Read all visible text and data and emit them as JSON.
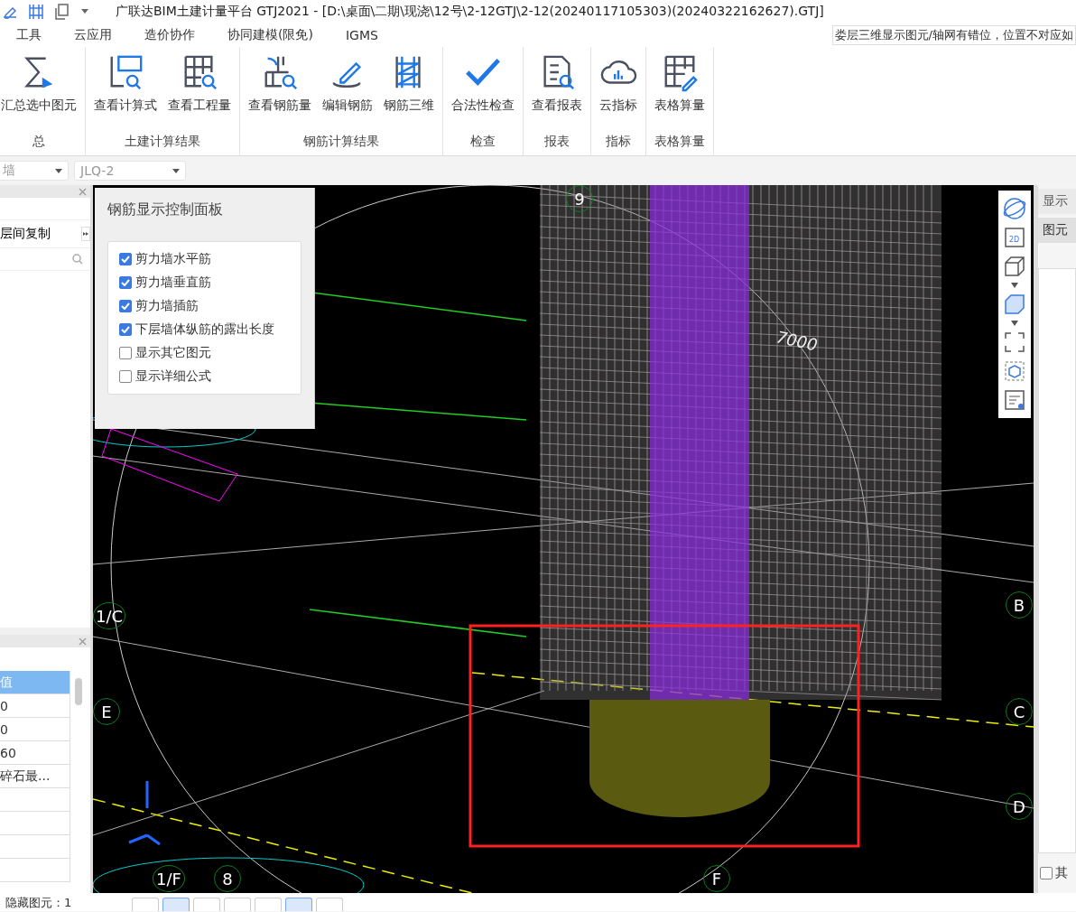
{
  "title_bar": {
    "title": "广联达BIM土建计量平台 GTJ2021 - [D:\\桌面\\二期\\现浇\\12号\\2-12GTJ\\2-12(20240117105303)(20240322162627).GTJ]"
  },
  "menu": [
    "工具",
    "云应用",
    "造价协作",
    "协同建模(限免)",
    "IGMS"
  ],
  "notice": "娄层三维显示图元/轴网有错位，位置不对应如",
  "ribbon": [
    {
      "group": "总",
      "buttons": [
        {
          "label": "汇总选中图元",
          "kind": "sum"
        }
      ]
    },
    {
      "group": "土建计算结果",
      "buttons": [
        {
          "label": "查看计算式",
          "kind": "formula"
        },
        {
          "label": "查看工程量",
          "kind": "table"
        }
      ]
    },
    {
      "group": "钢筋计算结果",
      "buttons": [
        {
          "label": "查看钢筋量",
          "kind": "rebar"
        },
        {
          "label": "编辑钢筋",
          "kind": "edit"
        },
        {
          "label": "钢筋三维",
          "kind": "frame"
        }
      ]
    },
    {
      "group": "检查",
      "buttons": [
        {
          "label": "合法性检查",
          "kind": "check"
        }
      ]
    },
    {
      "group": "报表",
      "buttons": [
        {
          "label": "查看报表",
          "kind": "report"
        }
      ]
    },
    {
      "group": "指标",
      "buttons": [
        {
          "label": "云指标",
          "kind": "cloud"
        }
      ]
    },
    {
      "group": "表格算量",
      "buttons": [
        {
          "label": "表格算量",
          "kind": "sheet"
        }
      ]
    }
  ],
  "selectors": [
    "墙",
    "JLQ-2"
  ],
  "left_panel": {
    "copy_button": "层间复制",
    "property_header": "值",
    "property_values": [
      "0",
      "0",
      "60",
      "碎石最..."
    ]
  },
  "control_panel": {
    "title": "钢筋显示控制面板",
    "options": [
      {
        "label": "剪力墙水平筋",
        "checked": true
      },
      {
        "label": "剪力墙垂直筋",
        "checked": true
      },
      {
        "label": "剪力墙插筋",
        "checked": true
      },
      {
        "label": "下层墙体纵筋的露出长度",
        "checked": true
      },
      {
        "label": "显示其它图元",
        "checked": false
      },
      {
        "label": "显示详细公式",
        "checked": false
      }
    ]
  },
  "viewport": {
    "dimension": "7000",
    "axis_labels": [
      "9",
      "B",
      "1/C",
      "E",
      "C",
      "D",
      "1/F",
      "8",
      "F"
    ],
    "view_2d_label": "2D"
  },
  "right_panel": {
    "tabs": [
      {
        "label": "显示",
        "selected": false
      },
      {
        "label": "图元",
        "selected": true
      }
    ],
    "bottom_option": {
      "label": "其",
      "checked": false
    }
  },
  "status_bar": {
    "hidden_count": "隐藏图元：1"
  },
  "snap_tools": [
    {
      "selected": false
    },
    {
      "selected": true
    },
    {
      "selected": false
    },
    {
      "selected": false
    },
    {
      "selected": false
    },
    {
      "selected": true
    },
    {
      "selected": false
    }
  ]
}
